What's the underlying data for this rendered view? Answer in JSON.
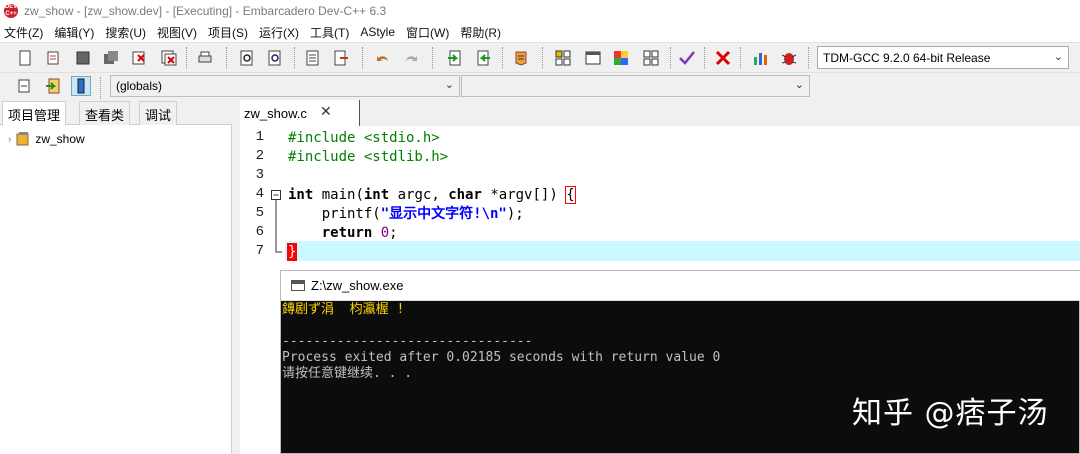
{
  "window": {
    "title": "zw_show - [zw_show.dev] - [Executing] - Embarcadero Dev-C++ 6.3",
    "icon_label": "DEV C++"
  },
  "menu": [
    "文件(Z)",
    "编辑(Y)",
    "搜索(U)",
    "视图(V)",
    "项目(S)",
    "运行(X)",
    "工具(T)",
    "AStyle",
    "窗口(W)",
    "帮助(R)"
  ],
  "toolbar": {
    "compiler": "TDM-GCC 9.2.0 64-bit Release",
    "icons": [
      "new-file-icon",
      "open-file-icon",
      "save-icon",
      "save-all-icon",
      "close-icon",
      "close-all-icon",
      "print-icon",
      "find-icon",
      "replace-icon",
      "goto-line-icon",
      "toggle-bookmark-icon",
      "undo-icon",
      "redo-icon",
      "indent-icon",
      "unindent-icon",
      "comment-icon",
      "compile-icon",
      "run-icon",
      "compile-run-icon",
      "rebuild-icon",
      "syntax-check-icon",
      "stop-icon",
      "chart-icon",
      "debug-icon"
    ]
  },
  "toolbar2": {
    "scope": "(globals)",
    "member": ""
  },
  "left_panel": {
    "tabs": [
      "项目管理",
      "查看类",
      "调试"
    ],
    "tree": [
      {
        "label": "zw_show"
      }
    ]
  },
  "editor": {
    "tab": "zw_show.c",
    "line_numbers": [
      "1",
      "2",
      "3",
      "4",
      "5",
      "6",
      "7"
    ],
    "lines": {
      "l1": "#include <stdio.h>",
      "l2": "#include <stdlib.h>",
      "l4_kw1": "int",
      "l4_mid": " main(",
      "l4_kw2": "int",
      "l4_a": " argc, ",
      "l4_kw3": "char",
      "l4_b": " *argv[]) ",
      "l4_brace": "{",
      "l5_a": "    printf(",
      "l5_str": "\"显示中文字符!\\n\"",
      "l5_b": ");",
      "l6_kw": "    return",
      "l6_num": " 0",
      "l6_b": ";",
      "l7_brace": "}"
    }
  },
  "console": {
    "title": "Z:\\zw_show.exe",
    "garbled": "鏄剧ず涓  枃瀛楃 !",
    "dashes": "--------------------------------",
    "exit_msg": "Process exited after 0.02185 seconds with return value 0",
    "press_key": "请按任意键继续. . ."
  },
  "watermark": "知乎 @痞子汤"
}
